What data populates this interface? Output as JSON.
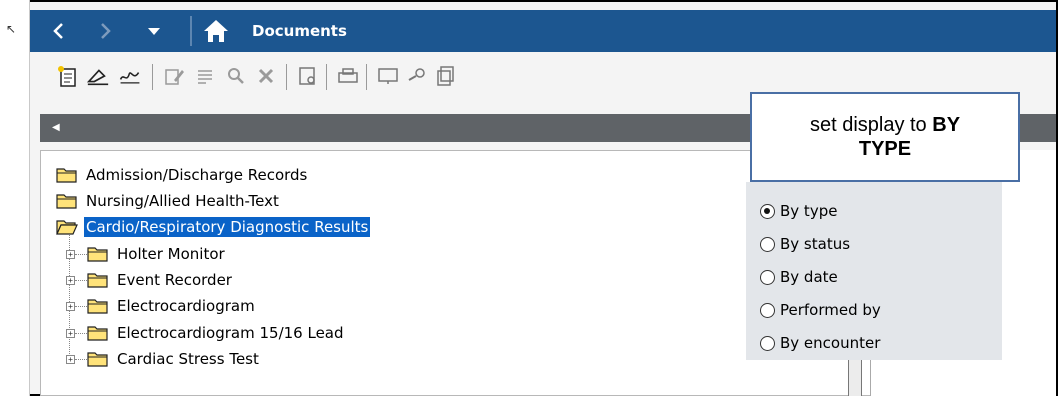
{
  "header": {
    "title": "Documents",
    "back_icon": "chevron-left-icon",
    "forward_icon": "chevron-right-icon",
    "dropdown_icon": "caret-down-icon",
    "home_icon": "home-icon",
    "color": "#1c5690"
  },
  "toolbar": {
    "icons": [
      "new-document-icon",
      "sign-icon",
      "forward-sign-icon",
      "modify-icon",
      "review-icon",
      "search-icon",
      "delete-icon",
      "preview-icon",
      "print-icon",
      "display-icon",
      "view-icon",
      "copy-icon"
    ]
  },
  "tree": {
    "items": [
      {
        "label": "Admission/Discharge Records",
        "level": 0,
        "open": false,
        "selected": false
      },
      {
        "label": "Nursing/Allied Health-Text",
        "level": 0,
        "open": false,
        "selected": false
      },
      {
        "label": "Cardio/Respiratory Diagnostic Results",
        "level": 0,
        "open": true,
        "selected": true
      },
      {
        "label": "Holter Monitor",
        "level": 1,
        "open": false,
        "selected": false
      },
      {
        "label": "Event Recorder",
        "level": 1,
        "open": false,
        "selected": false
      },
      {
        "label": "Electrocardiogram",
        "level": 1,
        "open": false,
        "selected": false
      },
      {
        "label": "Electrocardiogram 15/16 Lead",
        "level": 1,
        "open": false,
        "selected": false
      },
      {
        "label": "Cardiac Stress Test",
        "level": 1,
        "open": false,
        "selected": false
      }
    ],
    "selected_color": "#0a63c8"
  },
  "callout": {
    "line1_prefix": "set display to ",
    "line1_bold": "BY",
    "line2_bold": "TYPE"
  },
  "display_options": {
    "selected": "By type",
    "options": [
      "By type",
      "By status",
      "By date",
      "Performed by",
      "By encounter"
    ]
  }
}
